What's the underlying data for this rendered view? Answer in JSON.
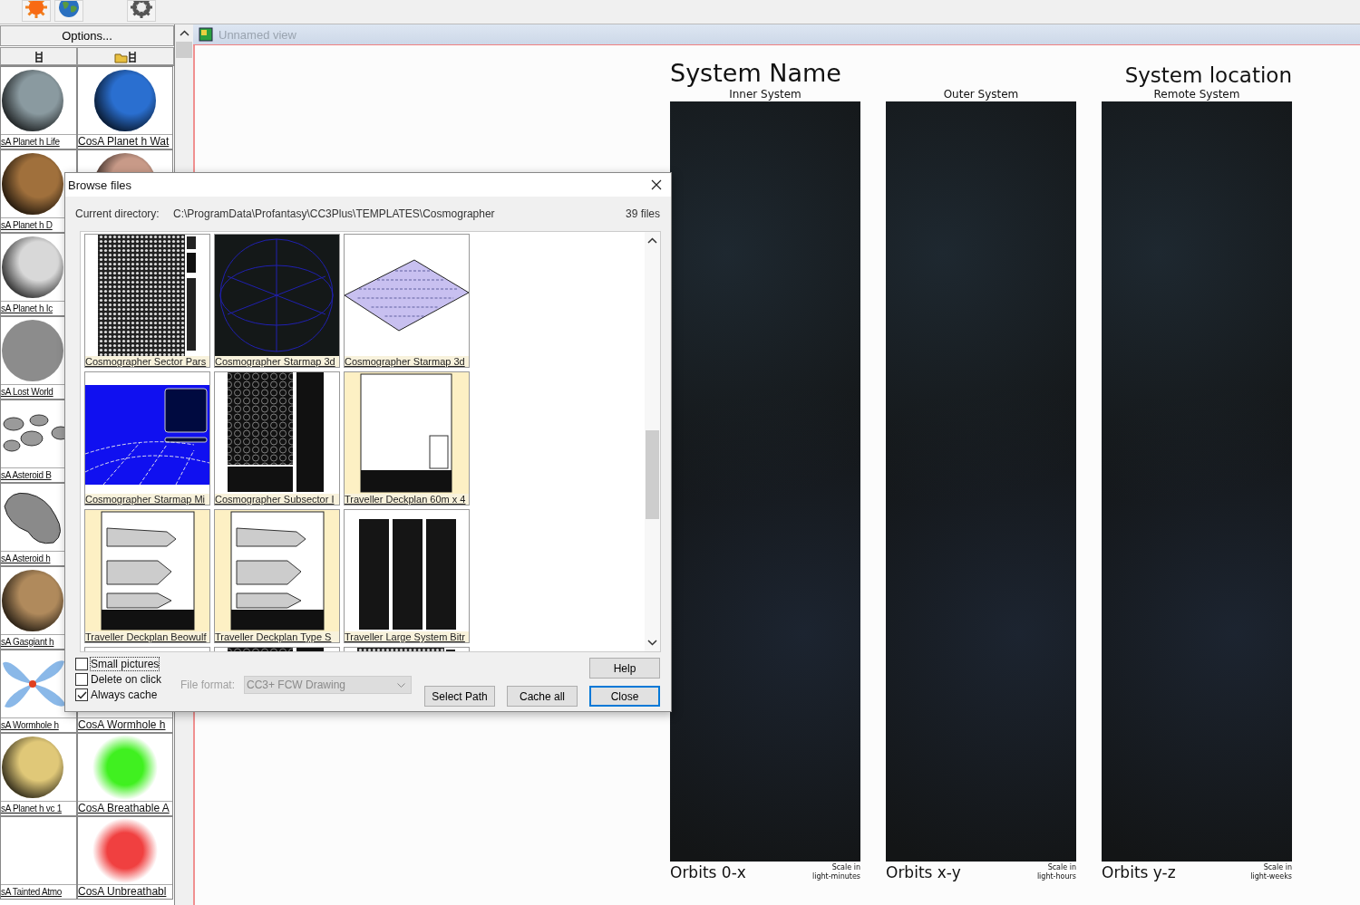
{
  "toolbar": {
    "buttons": [
      {
        "kind": "sun"
      },
      {
        "kind": "globe"
      },
      {
        "kind": "gear"
      }
    ]
  },
  "symbol_panel": {
    "options_button": "Options...",
    "tool_buttons": [
      {
        "kind": "ladder"
      },
      {
        "kind": "folder"
      }
    ],
    "symbols": [
      {
        "label": "sA Planet h Life",
        "kind": "planet",
        "color": "#8a9aa0"
      },
      {
        "label": "CosA Planet h Wat",
        "kind": "planet",
        "color": "#2a6fd0"
      },
      {
        "label": "sA Planet h D",
        "kind": "planet",
        "color": "#a0703c"
      },
      {
        "kind": "planet",
        "color": "#c89a88"
      },
      {
        "label": "sA Planet h Ic",
        "kind": "planet",
        "color": "#d8d8d8"
      },
      {
        "kind": "blank"
      },
      {
        "label": "sA Lost World",
        "kind": "flat",
        "color": "#8c8c8c"
      },
      {
        "kind": "blank"
      },
      {
        "label": "sA Asteroid B",
        "kind": "asteroids",
        "color": "#9a9a9a"
      },
      {
        "kind": "blank"
      },
      {
        "label": "sA Asteroid h",
        "kind": "asteroid",
        "color": "#8a8a8a"
      },
      {
        "kind": "blank"
      },
      {
        "label": "sA Gasgiant h",
        "kind": "planet",
        "color": "#b08a5c"
      },
      {
        "kind": "blank"
      },
      {
        "label": "sA Wormhole h",
        "kind": "wormhole",
        "color": "#8ab8e8"
      },
      {
        "label": "CosA Wormhole h",
        "kind": "blank"
      },
      {
        "label": "sA Planet h vc 1",
        "kind": "planet",
        "color": "#e0c878"
      },
      {
        "label": "CosA Breathable A",
        "kind": "glow",
        "color": "#40f020"
      },
      {
        "label": "sA Tainted Atmo",
        "kind": "blank"
      },
      {
        "label": "CosA Unbreathabl",
        "kind": "glow",
        "color": "#f04040"
      }
    ]
  },
  "view": {
    "title": "Unnamed view",
    "system_name": "System Name",
    "system_location": "System location",
    "panels": [
      {
        "heading": "Inner System",
        "caption": "Orbits 0-x",
        "scale_lines": [
          "Scale in",
          "light-minutes"
        ]
      },
      {
        "heading": "Outer System",
        "caption": "Orbits x-y",
        "scale_lines": [
          "Scale in",
          "light-hours"
        ]
      },
      {
        "heading": "Remote System",
        "caption": "Orbits y-z",
        "scale_lines": [
          "Scale in",
          "light-weeks"
        ]
      }
    ]
  },
  "dialog": {
    "title": "Browse files",
    "directory_label": "Current directory:",
    "directory": "C:\\ProgramData\\Profantasy\\CC3Plus\\TEMPLATES\\Cosmographer",
    "file_count": "39  files",
    "files": [
      {
        "label": "Cosmographer Sector Pars",
        "kind": "hexsheet"
      },
      {
        "label": "Cosmographer Starmap 3d",
        "kind": "sphere"
      },
      {
        "label": "Cosmographer Starmap 3d",
        "kind": "diamond"
      },
      {
        "label": "Cosmographer Starmap Mi",
        "kind": "bluemap"
      },
      {
        "label": "Cosmographer Subsector I",
        "kind": "subsector"
      },
      {
        "label": "Traveller Deckplan 60m x 4",
        "kind": "deckplan"
      },
      {
        "label": "Traveller Deckplan Beowulf",
        "kind": "ship"
      },
      {
        "label": "Traveller Deckplan Type S",
        "kind": "ship"
      },
      {
        "label": "Traveller Large System Bitr",
        "kind": "columns"
      },
      {
        "kind": "columns"
      },
      {
        "kind": "subsector"
      },
      {
        "kind": "hexsheet"
      }
    ],
    "options": [
      {
        "label": "Small pictures",
        "checked": false
      },
      {
        "label": "Delete on click",
        "checked": false
      },
      {
        "label": "Always cache",
        "checked": true
      }
    ],
    "file_format": {
      "label": "File format:",
      "value": "CC3+ FCW Drawing",
      "disabled": true
    },
    "buttons": [
      {
        "label": "Help",
        "kind": "help"
      },
      {
        "label": "Select Path",
        "kind": "normal"
      },
      {
        "label": "Cache all",
        "kind": "normal"
      },
      {
        "label": "Close",
        "kind": "default"
      }
    ]
  }
}
